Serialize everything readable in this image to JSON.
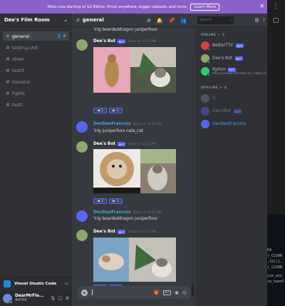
{
  "nitro": {
    "text": "Nitro now starting at $2.99/mo. Emoji anywhere, bigger uploads, and more.",
    "button": "Learn More",
    "close": "✕"
  },
  "server": {
    "name": "Dee's Film Room",
    "channels": [
      {
        "name": "general",
        "active": true
      },
      {
        "name": "testing-shit"
      },
      {
        "name": "other"
      },
      {
        "name": "testtt"
      },
      {
        "name": "General"
      },
      {
        "name": "fights"
      },
      {
        "name": "testt"
      }
    ]
  },
  "activity": {
    "label": "Visual Studio Code"
  },
  "user": {
    "name": "DearMrFle...",
    "tag": "#9704"
  },
  "channel": {
    "title": "general"
  },
  "chat": {
    "cmd1": "'irig beardeddragon juniperfoxx",
    "msg1": {
      "name": "Dee's Bot",
      "tag": "BOT",
      "time": "Today at 12:21 PM"
    },
    "react1": {
      "a": "1",
      "b": "1"
    },
    "msg2": {
      "name": "DevDeeFrancois",
      "time": "Today at 12:26 PM",
      "text": "'irig juniperfoxx nala_cat"
    },
    "msg3": {
      "name": "Dee's Bot",
      "tag": "BOT",
      "time": "Today at 12:27 PM"
    },
    "react3": {
      "a": "1",
      "b": "1"
    },
    "msg4": {
      "name": "DevDeeFrancois",
      "time": "Today at 12:27 PM",
      "text": "'irig beardeddragon juniperfoxx"
    },
    "msg5": {
      "name": "Dee's Bot",
      "tag": "BOT",
      "time": "Today at 12:27 PM"
    },
    "react5": {
      "a": "1",
      "b": "1"
    }
  },
  "search": {
    "placeholder": "Search"
  },
  "members": {
    "online_header": "ONLINE — 3",
    "offline_header": "OFFLINE — 3",
    "online": [
      {
        "name": "BetterTTV",
        "tag": "BOT",
        "color": "#b9bbbe"
      },
      {
        "name": "Dee's Bot",
        "tag": "BOT",
        "color": "#b9bbbe"
      },
      {
        "name": "Rythm",
        "tag": "BOT",
        "sub": "Playing www.rythmbot.co | https://r...",
        "color": "#b9bbbe"
      }
    ],
    "offline": [
      {
        "name": "D"
      },
      {
        "name": "Dee'sBot",
        "tag": "BOT"
      },
      {
        "name": "DevDeeFrancois",
        "color": "#3fa6dd"
      }
    ]
  },
  "colors": {
    "accent": "#5865f2",
    "nitro": "#8a62c9",
    "online": "#43b581",
    "link_name": "#3fa6dd"
  }
}
